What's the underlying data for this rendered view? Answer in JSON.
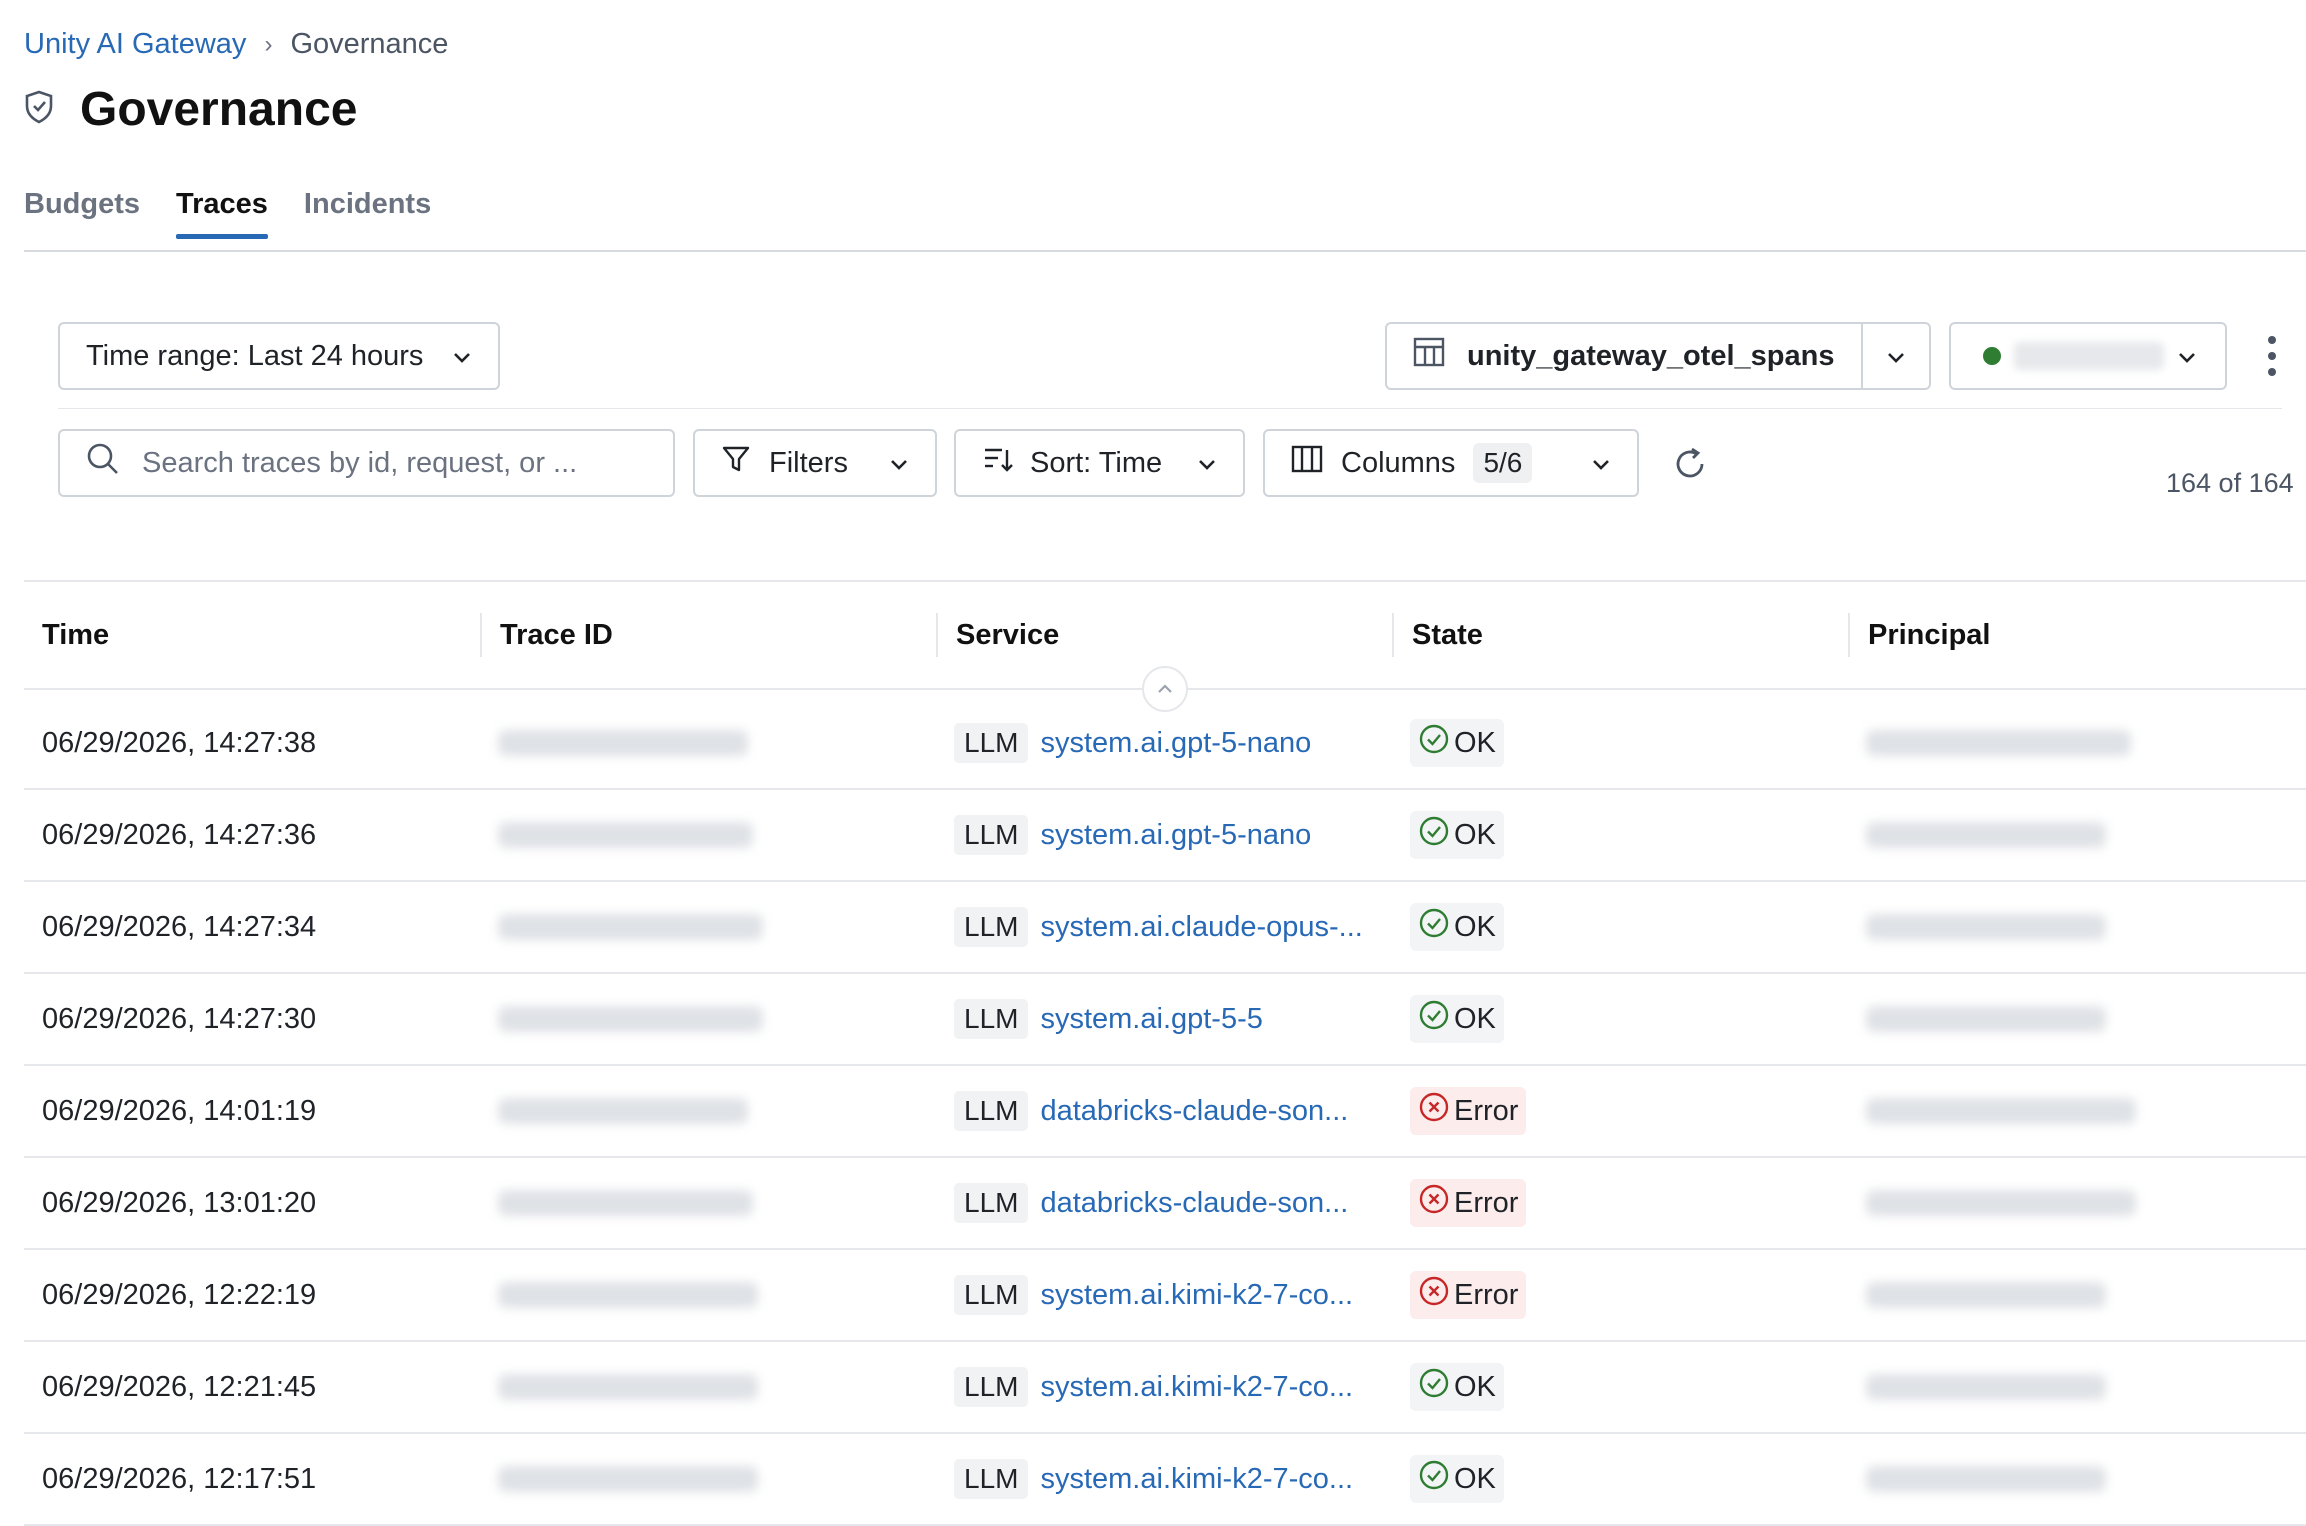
{
  "breadcrumb": {
    "parent": "Unity AI Gateway",
    "current": "Governance"
  },
  "page": {
    "title": "Governance"
  },
  "tabs": [
    {
      "label": "Budgets"
    },
    {
      "label": "Traces"
    },
    {
      "label": "Incidents"
    }
  ],
  "toolbar": {
    "time_range": "Time range: Last 24 hours",
    "table_name": "unity_gateway_otel_spans",
    "search_placeholder": "Search traces by id, request, or ...",
    "filters": "Filters",
    "sort": "Sort: Time",
    "columns": "Columns",
    "columns_badge": "5/6",
    "count": "164 of 164"
  },
  "table": {
    "headers": [
      "Time",
      "Trace ID",
      "Service",
      "State",
      "Principal"
    ],
    "rows": [
      {
        "time": "06/29/2026, 14:27:38",
        "type": "LLM",
        "service": "system.ai.gpt-5-nano",
        "state": "OK"
      },
      {
        "time": "06/29/2026, 14:27:36",
        "type": "LLM",
        "service": "system.ai.gpt-5-nano",
        "state": "OK"
      },
      {
        "time": "06/29/2026, 14:27:34",
        "type": "LLM",
        "service": "system.ai.claude-opus-...",
        "state": "OK"
      },
      {
        "time": "06/29/2026, 14:27:30",
        "type": "LLM",
        "service": "system.ai.gpt-5-5",
        "state": "OK"
      },
      {
        "time": "06/29/2026, 14:01:19",
        "type": "LLM",
        "service": "databricks-claude-son...",
        "state": "Error"
      },
      {
        "time": "06/29/2026, 13:01:20",
        "type": "LLM",
        "service": "databricks-claude-son...",
        "state": "Error"
      },
      {
        "time": "06/29/2026, 12:22:19",
        "type": "LLM",
        "service": "system.ai.kimi-k2-7-co...",
        "state": "Error"
      },
      {
        "time": "06/29/2026, 12:21:45",
        "type": "LLM",
        "service": "system.ai.kimi-k2-7-co...",
        "state": "OK"
      },
      {
        "time": "06/29/2026, 12:17:51",
        "type": "LLM",
        "service": "system.ai.kimi-k2-7-co...",
        "state": "OK"
      }
    ]
  },
  "colors": {
    "link": "#2869b6",
    "ok": "#2e7d32",
    "error": "#c62828",
    "online_dot": "#2e7d32"
  }
}
